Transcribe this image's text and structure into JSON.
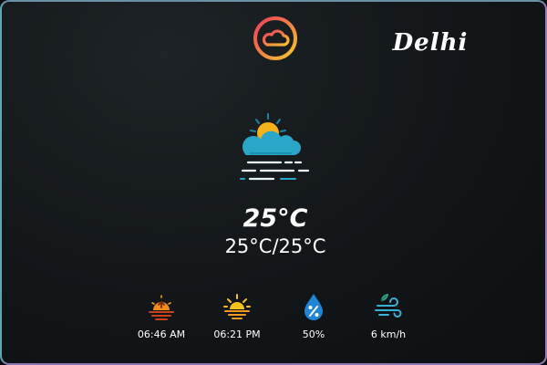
{
  "header": {
    "logo_icon": "cloud-logo-icon",
    "city": "Delhi"
  },
  "current": {
    "condition_icon": "partly-cloudy-fog-icon",
    "temperature": "25°C",
    "range": "25°C/25°C"
  },
  "stats": [
    {
      "icon": "sunrise-icon",
      "value": "06:46 AM"
    },
    {
      "icon": "sunset-icon",
      "value": "06:21 PM"
    },
    {
      "icon": "humidity-icon",
      "value": "50%"
    },
    {
      "icon": "wind-icon",
      "value": "6 km/h"
    }
  ],
  "colors": {
    "background": "#14181b",
    "border_accent": "#7a6fa8",
    "sun": "#f6b21a",
    "cloud": "#2aa6c8",
    "logo_gradient_start": "#ef3c5a",
    "logo_gradient_end": "#f7c62f",
    "humidity": "#1f86d6"
  }
}
